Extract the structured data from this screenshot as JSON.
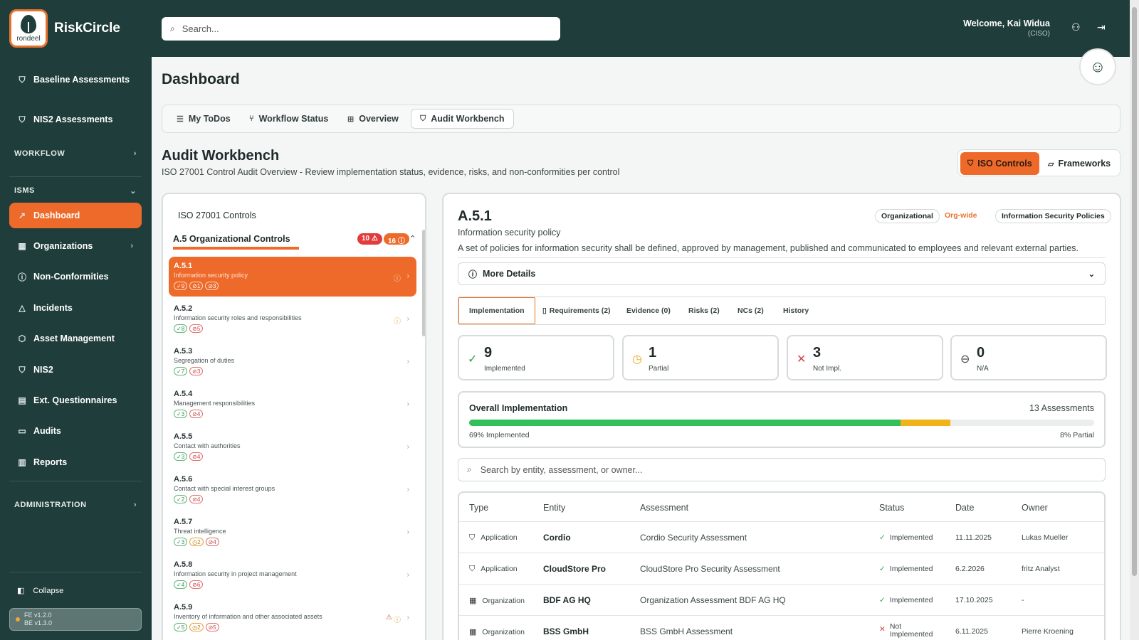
{
  "brand": {
    "name": "RiskCircle",
    "logo_text": "rondeel"
  },
  "sidebar": {
    "items_top": [
      {
        "label": "Baseline Assessments",
        "icon": "shield-icon"
      },
      {
        "label": "NIS2 Assessments",
        "icon": "shield-icon"
      }
    ],
    "sections": {
      "workflow": "WORKFLOW",
      "isms": "ISMS",
      "administration": "ADMINISTRATION"
    },
    "isms_items": [
      {
        "label": "Dashboard",
        "icon": "trend-icon"
      },
      {
        "label": "Organizations",
        "icon": "building-icon"
      },
      {
        "label": "Non-Conformities",
        "icon": "info-icon"
      },
      {
        "label": "Incidents",
        "icon": "warning-icon"
      },
      {
        "label": "Asset Management",
        "icon": "box-icon"
      },
      {
        "label": "NIS2",
        "icon": "shield-icon"
      },
      {
        "label": "Ext. Questionnaires",
        "icon": "clipboard-icon"
      },
      {
        "label": "Audits",
        "icon": "document-icon"
      },
      {
        "label": "Reports",
        "icon": "bar-chart-icon"
      }
    ],
    "collapse_label": "Collapse",
    "version_fe": "FE v1.2.0",
    "version_be": "BE v1.3.0"
  },
  "topbar": {
    "search_placeholder": "Search...",
    "welcome": "Welcome, Kai Widua",
    "role": "(CISO)"
  },
  "page": {
    "title": "Dashboard"
  },
  "tabs": [
    "My ToDos",
    "Workflow Status",
    "Overview",
    "Audit Workbench"
  ],
  "workbench": {
    "title": "Audit Workbench",
    "subtitle": "ISO 27001 Control Audit Overview - Review implementation status, evidence, risks, and non-conformities per control",
    "toggle": [
      "ISO Controls",
      "Frameworks"
    ]
  },
  "controls_panel": {
    "title": "ISO 27001 Controls",
    "group": {
      "title": "A.5 Organizational Controls",
      "badge_red": "10",
      "badge_orange": "16"
    },
    "controls": [
      {
        "id": "A.5.1",
        "name": "Information security policy",
        "pills": [
          [
            "g",
            "9"
          ],
          [
            "r",
            "1"
          ],
          [
            "r",
            "3"
          ]
        ]
      },
      {
        "id": "A.5.2",
        "name": "Information security roles and responsibilities",
        "pills": [
          [
            "g",
            "8"
          ],
          [
            "r",
            "5"
          ]
        ]
      },
      {
        "id": "A.5.3",
        "name": "Segregation of duties",
        "pills": [
          [
            "g",
            "7"
          ],
          [
            "r",
            "3"
          ]
        ]
      },
      {
        "id": "A.5.4",
        "name": "Management responsibilities",
        "pills": [
          [
            "g",
            "3"
          ],
          [
            "r",
            "4"
          ]
        ]
      },
      {
        "id": "A.5.5",
        "name": "Contact with authorities",
        "pills": [
          [
            "g",
            "3"
          ],
          [
            "r",
            "4"
          ]
        ]
      },
      {
        "id": "A.5.6",
        "name": "Contact with special interest groups",
        "pills": [
          [
            "g",
            "2"
          ],
          [
            "r",
            "4"
          ]
        ]
      },
      {
        "id": "A.5.7",
        "name": "Threat intelligence",
        "pills": [
          [
            "g",
            "3"
          ],
          [
            "o",
            "2"
          ],
          [
            "r",
            "4"
          ]
        ]
      },
      {
        "id": "A.5.8",
        "name": "Information security in project management",
        "pills": [
          [
            "g",
            "4"
          ],
          [
            "r",
            "6"
          ]
        ]
      },
      {
        "id": "A.5.9",
        "name": "Inventory of information and other associated assets",
        "pills": [
          [
            "g",
            "5"
          ],
          [
            "o",
            "2"
          ],
          [
            "r",
            "5"
          ]
        ]
      }
    ]
  },
  "detail": {
    "id": "A.5.1",
    "name": "Information security policy",
    "description": "A set of policies for information security shall be defined, approved by management, published and communicated to employees and relevant external parties.",
    "tags": [
      "Organizational",
      "Org-wide",
      "Information Security Policies"
    ],
    "more_details": "More Details",
    "subtabs": [
      "Implementation",
      "Requirements (2)",
      "Evidence (0)",
      "Risks (2)",
      "NCs (2)",
      "History"
    ],
    "stats": [
      {
        "value": "9",
        "label": "Implemented",
        "color": "#31a04f"
      },
      {
        "value": "1",
        "label": "Partial",
        "color": "#e8a91a"
      },
      {
        "value": "3",
        "label": "Not Impl.",
        "color": "#d04848"
      },
      {
        "value": "0",
        "label": "N/A",
        "color": "#444444"
      }
    ],
    "overall": {
      "title": "Overall Implementation",
      "count": "13 Assessments",
      "implemented_pct": 69,
      "partial_pct": 8,
      "implemented_label": "69% Implemented",
      "partial_label": "8% Partial"
    },
    "table_search_placeholder": "Search by entity, assessment, or owner...",
    "table": {
      "headers": [
        "Type",
        "Entity",
        "Assessment",
        "Status",
        "Date",
        "Owner"
      ],
      "rows": [
        {
          "type": "Application",
          "entity": "Cordio",
          "assessment": "Cordio Security Assessment",
          "status": "Implemented",
          "date": "11.11.2025",
          "owner": "Lukas Mueller"
        },
        {
          "type": "Application",
          "entity": "CloudStore Pro",
          "assessment": "CloudStore Pro Security Assessment",
          "status": "Implemented",
          "date": "6.2.2026",
          "owner": "fritz Analyst"
        },
        {
          "type": "Organization",
          "entity": "BDF AG HQ",
          "assessment": "Organization Assessment BDF AG HQ",
          "status": "Implemented",
          "date": "17.10.2025",
          "owner": "-"
        },
        {
          "type": "Organization",
          "entity": "BSS GmbH",
          "assessment": "BSS GmbH Assessment",
          "status": "Not Implemented",
          "date": "6.11.2025",
          "owner": "Pierre Kroening"
        }
      ]
    }
  }
}
